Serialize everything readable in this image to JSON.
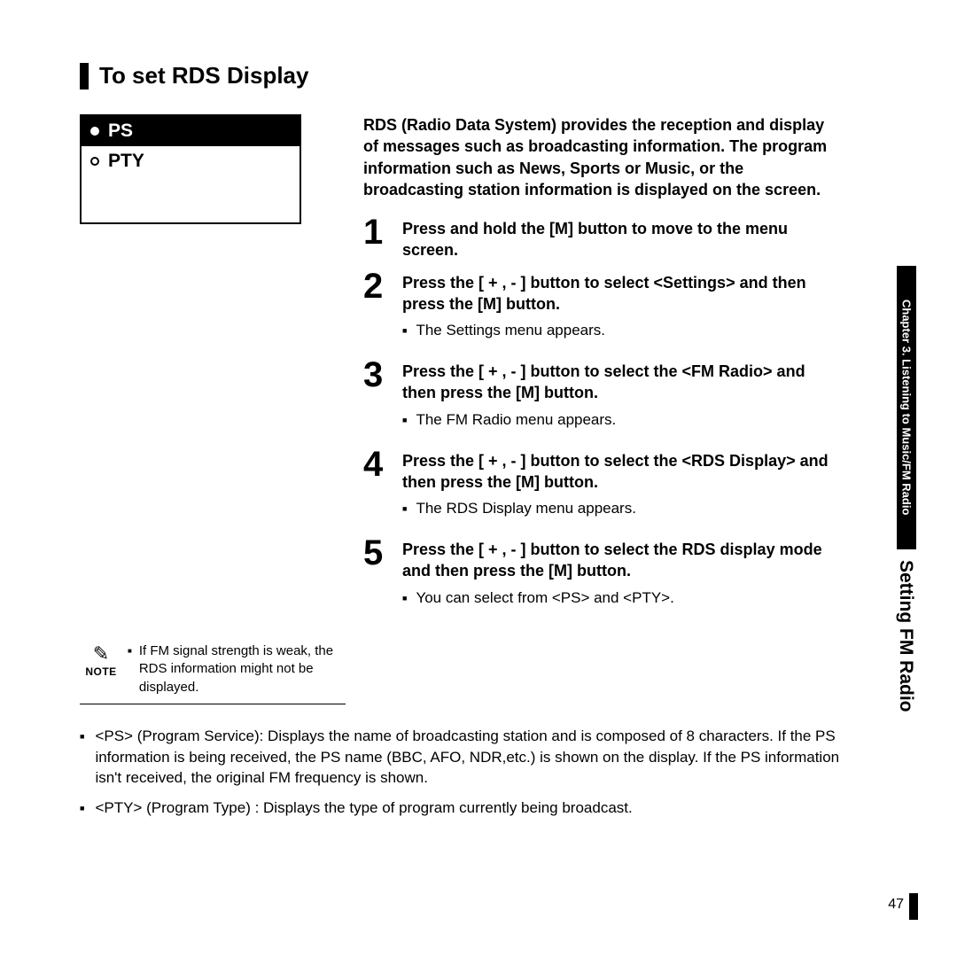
{
  "heading": "To set RDS Display",
  "device": {
    "selected": "PS",
    "unselected": "PTY"
  },
  "intro": "RDS (Radio Data System) provides the reception and display of messages such as broadcasting information. The program information such as News, Sports or Music, or the broadcasting station information is displayed on the screen.",
  "steps": {
    "s1": {
      "num": "1",
      "title_a": "Press and hold the [",
      "title_m": "M",
      "title_b": "] button to move to the menu screen."
    },
    "s2": {
      "num": "2",
      "title_a": "Press the [ + , - ] button to select <Settings> and then press the [",
      "title_m": "M",
      "title_b": "] button.",
      "sub": "The Settings menu appears."
    },
    "s3": {
      "num": "3",
      "title_a": "Press the [ + , - ] button to select the <FM Radio> and then press the [",
      "title_m": "M",
      "title_b": "] button.",
      "sub": "The FM Radio menu appears."
    },
    "s4": {
      "num": "4",
      "title_a": "Press the [ + , - ] button to select the <RDS Display> and then press the [",
      "title_m": "M",
      "title_b": "] button.",
      "sub": "The RDS Display menu appears."
    },
    "s5": {
      "num": "5",
      "title_a": "Press the [ + , - ] button to select the RDS display mode and then press the [",
      "title_m": "M",
      "title_b": "] button.",
      "sub": "You can select from <PS> and <PTY>."
    }
  },
  "note": {
    "label": "NOTE",
    "text": "If FM signal strength is weak, the RDS information might not be displayed."
  },
  "defs": {
    "ps": "<PS> (Program Service): Displays the name of broadcasting station and is composed of 8 characters. If the PS information is being received, the PS name (BBC, AFO, NDR,etc.) is shown on the display. If the PS information isn't received, the original FM frequency is shown.",
    "pty": "<PTY> (Program Type) : Displays the type of program currently being broadcast."
  },
  "tab": {
    "chapter": "Chapter 3.  Listening to Music/FM Radio",
    "section": "Setting FM Radio"
  },
  "page_number": "47"
}
